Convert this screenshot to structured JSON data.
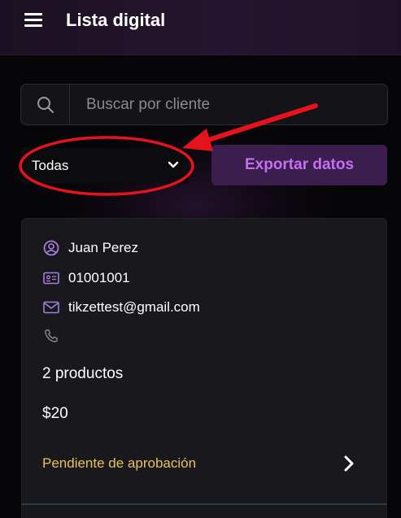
{
  "header": {
    "title": "Lista digital",
    "menu_icon": "hamburger-menu-icon"
  },
  "search": {
    "placeholder": "Buscar por cliente",
    "value": "",
    "icon": "search-icon"
  },
  "filter": {
    "selected": "Todas",
    "icon": "chevron-down-icon"
  },
  "export": {
    "label": "Exportar datos"
  },
  "order_card": {
    "name": "Juan Perez",
    "document_id": "01001001",
    "email": "tikzettest@gmail.com",
    "phone": "",
    "products": "2 productos",
    "price": "$20",
    "status": "Pendiente de aprobación"
  },
  "annotation": {
    "highlight_color": "#e5141c"
  },
  "colors": {
    "accent": "#c56ff3",
    "accent_bg": "#3b1e4d",
    "status": "#e7c25e",
    "icon": "#a77ddc"
  }
}
